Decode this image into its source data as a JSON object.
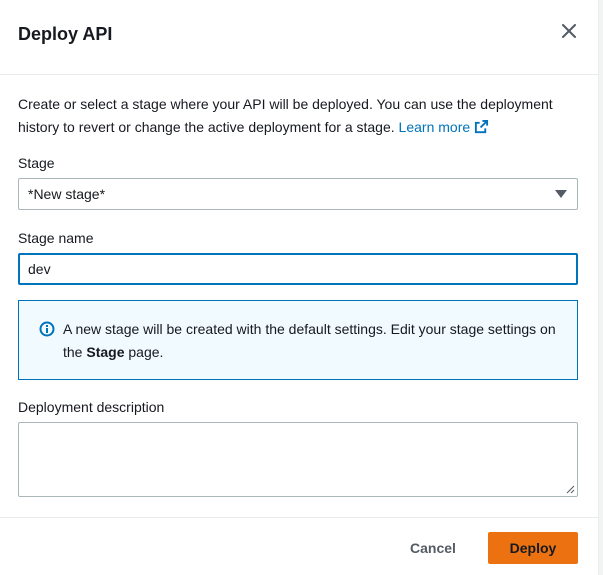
{
  "dialog": {
    "title": "Deploy API",
    "close_icon": "close-icon"
  },
  "intro": {
    "text": "Create or select a stage where your API will be deployed. You can use the deployment history to revert or change the active deployment for a stage.",
    "link_label": "Learn more",
    "link_icon": "external-link-icon"
  },
  "stage_select": {
    "label": "Stage",
    "value": "*New stage*",
    "caret_icon": "caret-down-icon"
  },
  "stage_name": {
    "label": "Stage name",
    "value": "dev"
  },
  "info_alert": {
    "icon": "info-icon",
    "text_before": "A new stage will be created with the default settings. Edit your stage settings on the ",
    "text_bold": "Stage",
    "text_after": " page."
  },
  "description": {
    "label": "Deployment description",
    "value": ""
  },
  "footer": {
    "cancel_label": "Cancel",
    "deploy_label": "Deploy"
  },
  "colors": {
    "primary": "#ec7211",
    "link": "#0073bb",
    "info_bg": "#f1faff"
  }
}
